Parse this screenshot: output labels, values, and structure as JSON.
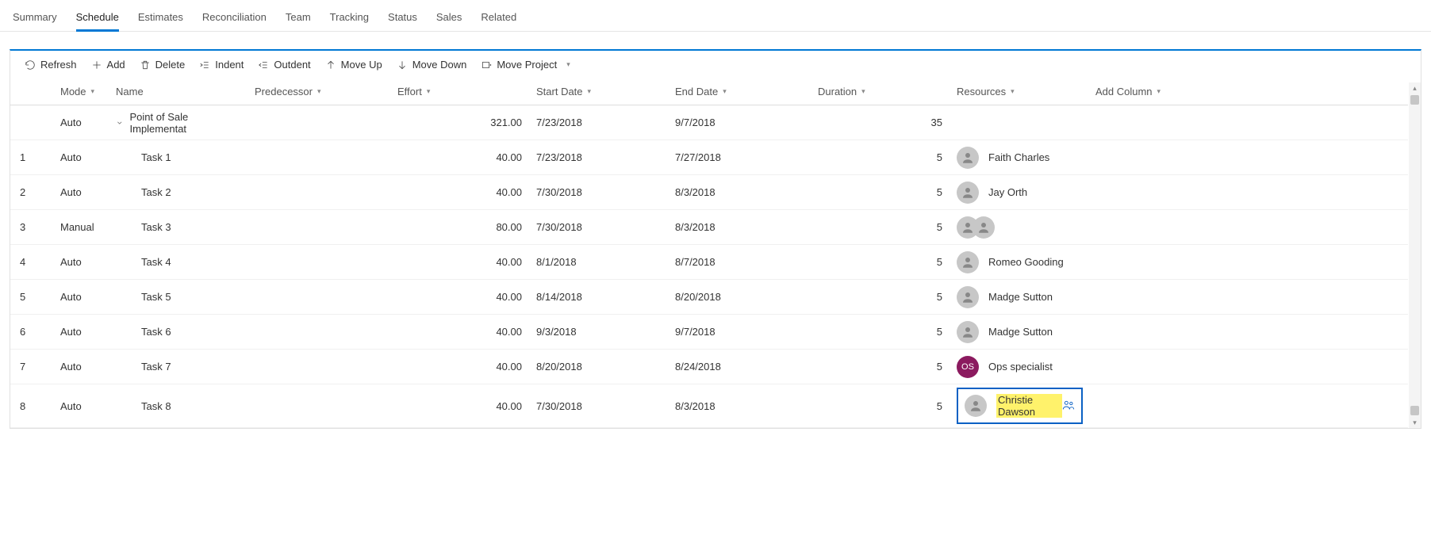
{
  "tabs": [
    "Summary",
    "Schedule",
    "Estimates",
    "Reconciliation",
    "Team",
    "Tracking",
    "Status",
    "Sales",
    "Related"
  ],
  "activeTab": "Schedule",
  "toolbar": {
    "refresh": "Refresh",
    "add": "Add",
    "delete": "Delete",
    "indent": "Indent",
    "outdent": "Outdent",
    "moveup": "Move Up",
    "movedown": "Move Down",
    "moveproject": "Move Project"
  },
  "columns": {
    "mode": "Mode",
    "name": "Name",
    "predecessor": "Predecessor",
    "effort": "Effort",
    "start": "Start Date",
    "end": "End Date",
    "duration": "Duration",
    "resources": "Resources",
    "add": "Add Column"
  },
  "parentRow": {
    "mode": "Auto",
    "name": "Point of Sale Implementat",
    "effort": "321.00",
    "start": "7/23/2018",
    "end": "9/7/2018",
    "duration": "35"
  },
  "rows": [
    {
      "idx": "1",
      "mode": "Auto",
      "name": "Task 1",
      "effort": "40.00",
      "start": "7/23/2018",
      "end": "7/27/2018",
      "duration": "5",
      "resource": "Faith Charles",
      "avatars": [
        {
          "type": "person"
        }
      ]
    },
    {
      "idx": "2",
      "mode": "Auto",
      "name": "Task 2",
      "effort": "40.00",
      "start": "7/30/2018",
      "end": "8/3/2018",
      "duration": "5",
      "resource": "Jay Orth",
      "avatars": [
        {
          "type": "person"
        }
      ]
    },
    {
      "idx": "3",
      "mode": "Manual",
      "name": "Task 3",
      "effort": "80.00",
      "start": "7/30/2018",
      "end": "8/3/2018",
      "duration": "5",
      "resource": "",
      "avatars": [
        {
          "type": "person"
        },
        {
          "type": "person"
        }
      ]
    },
    {
      "idx": "4",
      "mode": "Auto",
      "name": "Task 4",
      "effort": "40.00",
      "start": "8/1/2018",
      "end": "8/7/2018",
      "duration": "5",
      "resource": "Romeo Gooding",
      "avatars": [
        {
          "type": "person"
        }
      ]
    },
    {
      "idx": "5",
      "mode": "Auto",
      "name": "Task 5",
      "effort": "40.00",
      "start": "8/14/2018",
      "end": "8/20/2018",
      "duration": "5",
      "resource": "Madge Sutton",
      "avatars": [
        {
          "type": "person"
        }
      ]
    },
    {
      "idx": "6",
      "mode": "Auto",
      "name": "Task 6",
      "effort": "40.00",
      "start": "9/3/2018",
      "end": "9/7/2018",
      "duration": "5",
      "resource": "Madge Sutton",
      "avatars": [
        {
          "type": "person"
        }
      ]
    },
    {
      "idx": "7",
      "mode": "Auto",
      "name": "Task 7",
      "effort": "40.00",
      "start": "8/20/2018",
      "end": "8/24/2018",
      "duration": "5",
      "resource": "Ops specialist",
      "avatars": [
        {
          "type": "initials",
          "text": "OS"
        }
      ]
    },
    {
      "idx": "8",
      "mode": "Auto",
      "name": "Task 8",
      "effort": "40.00",
      "start": "7/30/2018",
      "end": "8/3/2018",
      "duration": "5",
      "resource": "Christie Dawson",
      "avatars": [
        {
          "type": "person"
        }
      ],
      "highlight": true
    }
  ]
}
